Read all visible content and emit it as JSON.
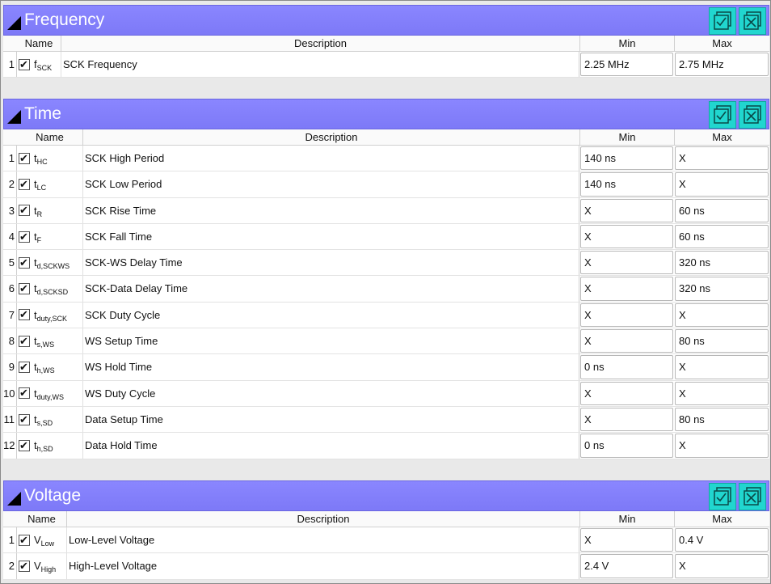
{
  "sections": {
    "frequency": {
      "title": "Frequency",
      "columns": [
        "Name",
        "Description",
        "Min",
        "Max"
      ],
      "rows": [
        {
          "idx": "1",
          "name": "f",
          "sub": "SCK",
          "desc": "SCK Frequency",
          "min": "2.25 MHz",
          "max": "2.75 MHz"
        }
      ]
    },
    "time": {
      "title": "Time",
      "columns": [
        "Name",
        "Description",
        "Min",
        "Max"
      ],
      "rows": [
        {
          "idx": "1",
          "name": "t",
          "sub": "HC",
          "desc": "SCK High Period",
          "min": "140 ns",
          "max": "X"
        },
        {
          "idx": "2",
          "name": "t",
          "sub": "LC",
          "desc": "SCK Low Period",
          "min": "140 ns",
          "max": "X"
        },
        {
          "idx": "3",
          "name": "t",
          "sub": "R",
          "desc": "SCK Rise Time",
          "min": "X",
          "max": "60 ns"
        },
        {
          "idx": "4",
          "name": "t",
          "sub": "F",
          "desc": "SCK Fall Time",
          "min": "X",
          "max": "60 ns"
        },
        {
          "idx": "5",
          "name": "t",
          "sub": "d,SCKWS",
          "desc": "SCK-WS Delay Time",
          "min": "X",
          "max": "320 ns"
        },
        {
          "idx": "6",
          "name": "t",
          "sub": "d,SCKSD",
          "desc": "SCK-Data Delay Time",
          "min": "X",
          "max": "320 ns"
        },
        {
          "idx": "7",
          "name": "t",
          "sub": "duty,SCK",
          "desc": "SCK Duty Cycle",
          "min": "X",
          "max": "X"
        },
        {
          "idx": "8",
          "name": "t",
          "sub": "s,WS",
          "desc": "WS Setup Time",
          "min": "X",
          "max": "80 ns"
        },
        {
          "idx": "9",
          "name": "t",
          "sub": "h,WS",
          "desc": "WS Hold Time",
          "min": "0 ns",
          "max": "X"
        },
        {
          "idx": "10",
          "name": "t",
          "sub": "duty,WS",
          "desc": "WS Duty Cycle",
          "min": "X",
          "max": "X"
        },
        {
          "idx": "11",
          "name": "t",
          "sub": "s,SD",
          "desc": "Data Setup Time",
          "min": "X",
          "max": "80 ns"
        },
        {
          "idx": "12",
          "name": "t",
          "sub": "h,SD",
          "desc": "Data Hold Time",
          "min": "0 ns",
          "max": "X"
        }
      ]
    },
    "voltage": {
      "title": "Voltage",
      "columns": [
        "Name",
        "Description",
        "Min",
        "Max"
      ],
      "rows": [
        {
          "idx": "1",
          "name": "V",
          "sub": "Low",
          "desc": "Low-Level Voltage",
          "min": "X",
          "max": "0.4 V"
        },
        {
          "idx": "2",
          "name": "V",
          "sub": "High",
          "desc": "High-Level Voltage",
          "min": "2.4 V",
          "max": "X"
        }
      ]
    }
  },
  "checkbox_mark": "✔",
  "colors": {
    "header": "#7d79f7",
    "button": "#21d6cf"
  },
  "icons": {
    "check_all": "check-all-icon",
    "uncheck_all": "uncheck-all-icon"
  }
}
